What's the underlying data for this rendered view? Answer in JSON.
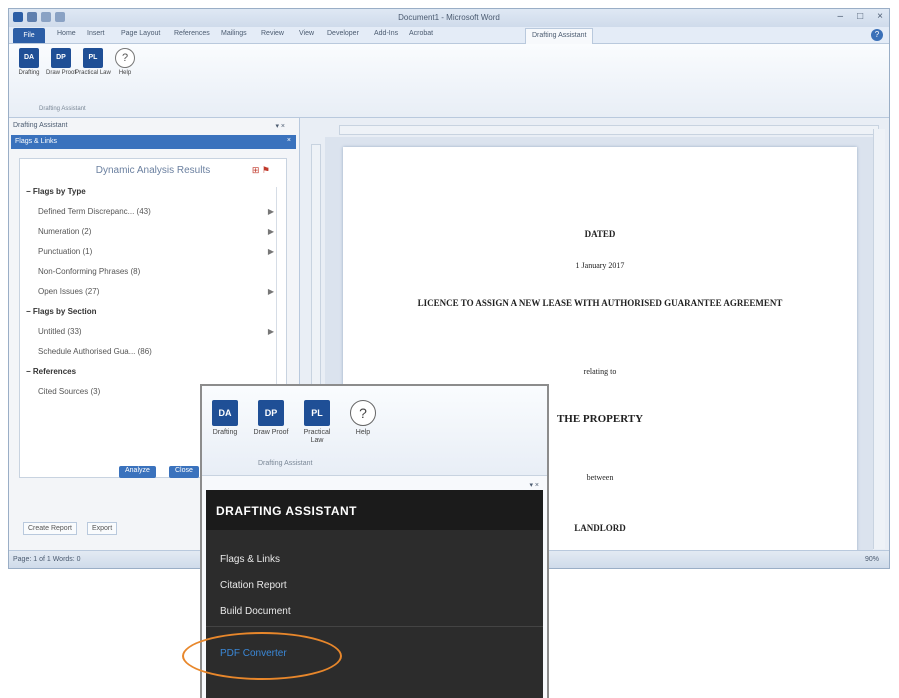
{
  "window": {
    "title": "Document1 - Microsoft Word",
    "controls": [
      "–",
      "□",
      "×"
    ]
  },
  "ribbon_tabs": [
    "File",
    "Home",
    "Insert",
    "Page Layout",
    "References",
    "Mailings",
    "Review",
    "View",
    "Developer",
    "Add-Ins",
    "Acrobat",
    "Drafting Assistant"
  ],
  "ribbon": {
    "buttons": [
      {
        "icon": "DA",
        "label": "Drafting"
      },
      {
        "icon": "DP",
        "label": "Draw Proof"
      },
      {
        "icon": "PL",
        "label": "Practical Law"
      },
      {
        "icon": "?",
        "label": "Help"
      }
    ],
    "group_label": "Drafting Assistant"
  },
  "task_pane": {
    "header": "Drafting Assistant",
    "bar": "Flags & Links",
    "results_title": "Dynamic Analysis Results",
    "sections": [
      {
        "title": "Flags by Type",
        "items": [
          "Defined Term Discrepanc... (43)",
          "Numeration (2)",
          "Punctuation (1)",
          "Non-Conforming Phrases (8)",
          "Open Issues (27)"
        ]
      },
      {
        "title": "Flags by Section",
        "items": [
          "Untitled (33)",
          "Schedule Authorised Gua... (86)"
        ]
      },
      {
        "title": "References",
        "items": [
          "Cited Sources (3)"
        ]
      }
    ],
    "buttons": {
      "analyze": "Analyze",
      "close": "Close"
    },
    "footer": {
      "report": "Create Report",
      "export": "Export"
    }
  },
  "document": {
    "lines": [
      "DATED",
      "1 January 2017",
      "LICENCE TO ASSIGN A NEW LEASE WITH AUTHORISED GUARANTEE AGREEMENT",
      "relating to",
      "THE PROPERTY",
      "between",
      "LANDLORD"
    ]
  },
  "statusbar": {
    "left": "Page: 1 of 1   Words: 0",
    "zoom": "90%"
  },
  "overlay": {
    "panel_title": "DRAFTING ASSISTANT",
    "menu": [
      "Flags & Links",
      "Citation Report",
      "Build Document"
    ],
    "highlighted_item": "PDF Converter"
  }
}
